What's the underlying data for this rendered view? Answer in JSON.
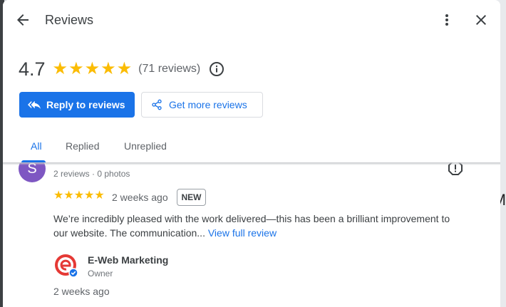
{
  "header": {
    "title": "Reviews",
    "back_icon": "arrow-left-icon",
    "more_icon": "more-vert-icon",
    "close_icon": "close-icon"
  },
  "summary": {
    "score": "4.7",
    "stars": 5,
    "count": "(71 reviews)",
    "star_color": "#fbbc04"
  },
  "actions": {
    "reply_label": "Reply to reviews",
    "get_more_label": "Get more reviews",
    "accent": "#1a73e8"
  },
  "tabs": [
    {
      "label": "All",
      "active": true
    },
    {
      "label": "Replied",
      "active": false
    },
    {
      "label": "Unreplied",
      "active": false
    }
  ],
  "review": {
    "avatar_letter": "S",
    "avatar_color": "#7e57c2",
    "meta": "2 reviews · 0 photos",
    "stars": 5,
    "ago": "2 weeks ago",
    "badge": "NEW",
    "text": "We’re incredibly pleased with the work delivered—this has been a brilliant improvement to our website. The communication...",
    "view_full": "View full review",
    "owner": {
      "name": "E-Web Marketing",
      "role": "Owner",
      "ago": "2 weeks ago"
    }
  },
  "background": {
    "edge_text": "M"
  }
}
